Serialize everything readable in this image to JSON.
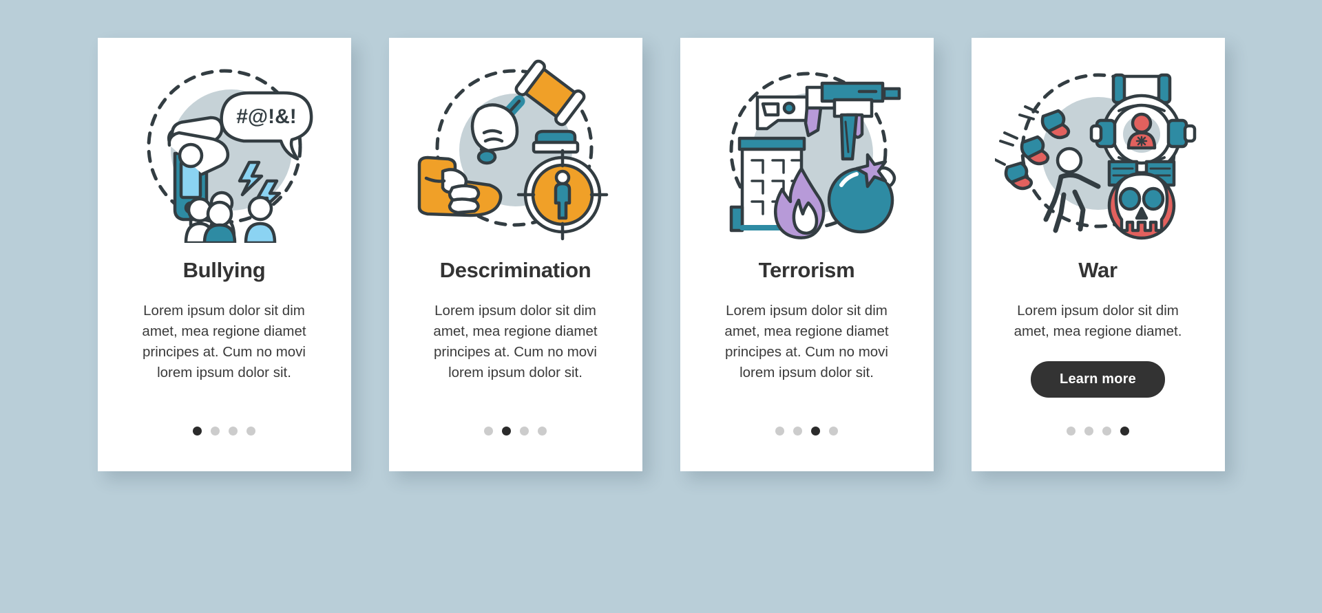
{
  "background_color": "#b9ced8",
  "palette": {
    "teal": "#2e8ba3",
    "light_blue": "#8bd3f2",
    "orange": "#f0a028",
    "purple": "#b79ad8",
    "red": "#e2615e",
    "gray_circle": "#c6d2d7",
    "outline": "#333d42",
    "title": "#333333",
    "body": "#3a3a3a",
    "dot_inactive": "#cccccc",
    "dot_active": "#2b2b2b",
    "button_bg": "#333333",
    "button_text": "#ffffff"
  },
  "cards": [
    {
      "id": "bullying",
      "illustration": "bullying-illustration",
      "speech_text": "#@!&!",
      "title": "Bullying",
      "body": "Lorem ipsum dolor sit dim amet, mea regione diamet principes at. Cum no movi lorem ipsum dolor sit.",
      "has_button": false,
      "button_label": "",
      "dots": {
        "count": 4,
        "active_index": 0
      }
    },
    {
      "id": "descrimination",
      "illustration": "discrimination-illustration",
      "title": "Descrimination",
      "body": "Lorem ipsum dolor sit dim amet, mea regione diamet principes at. Cum no movi lorem ipsum dolor sit.",
      "has_button": false,
      "button_label": "",
      "dots": {
        "count": 4,
        "active_index": 1
      }
    },
    {
      "id": "terrorism",
      "illustration": "terrorism-illustration",
      "title": "Terrorism",
      "body": "Lorem ipsum dolor sit dim amet, mea regione diamet principes at. Cum no movi lorem ipsum dolor sit.",
      "has_button": false,
      "button_label": "",
      "dots": {
        "count": 4,
        "active_index": 2
      }
    },
    {
      "id": "war",
      "illustration": "war-illustration",
      "title": "War",
      "body": "Lorem ipsum dolor sit dim amet, mea regione diamet.",
      "has_button": true,
      "button_label": "Learn more",
      "dots": {
        "count": 4,
        "active_index": 3
      }
    }
  ]
}
